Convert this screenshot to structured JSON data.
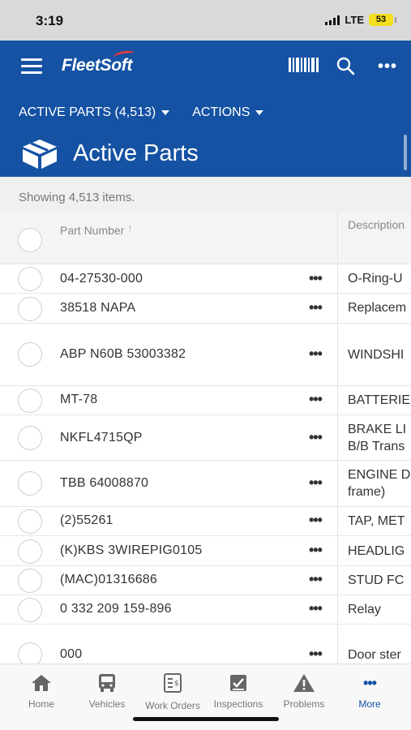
{
  "status_bar": {
    "time": "3:19",
    "network": "LTE",
    "battery": "53"
  },
  "header": {
    "logo": "FleetSoft",
    "filter_label": "ACTIVE PARTS (4,513)",
    "actions_label": "ACTIONS",
    "title": "Active Parts",
    "icons": [
      "hamburger-menu-icon",
      "barcode-icon",
      "search-icon",
      "more-icon",
      "parts-box-icon"
    ],
    "brand_color": "#1552a3"
  },
  "summary": {
    "showing_text": "Showing 4,513 items."
  },
  "table": {
    "headers": {
      "part_number": "Part Number",
      "sort_indicator": "↑",
      "description": "Description"
    },
    "rows": [
      {
        "part": "04-27530-000",
        "desc1": "O-Ring-U",
        "desc2": ""
      },
      {
        "part": "38518 NAPA",
        "desc1": "Replacem",
        "desc2": ""
      },
      {
        "part": "ABP N60B 53003382",
        "desc1": "WINDSHI",
        "desc2": ""
      },
      {
        "part": "MT-78",
        "desc1": "BATTERIE",
        "desc2": ""
      },
      {
        "part": "NKFL4715QP",
        "desc1": "BRAKE LI",
        "desc2": "B/B Trans"
      },
      {
        "part": "TBB 64008870",
        "desc1": "ENGINE D",
        "desc2": "frame)"
      },
      {
        "part": "(2)55261",
        "desc1": "TAP, MET",
        "desc2": ""
      },
      {
        "part": "(K)KBS 3WIREPIG0105",
        "desc1": "HEADLIG",
        "desc2": ""
      },
      {
        "part": "(MAC)01316686",
        "desc1": "STUD FC",
        "desc2": ""
      },
      {
        "part": "0 332 209 159-896",
        "desc1": "Relay",
        "desc2": ""
      },
      {
        "part": "000",
        "desc1": "Door ster",
        "desc2": ""
      }
    ],
    "row_action": "•••"
  },
  "bottom_nav": {
    "items": [
      {
        "label": "Home",
        "icon": "home-icon"
      },
      {
        "label": "Vehicles",
        "icon": "bus-icon"
      },
      {
        "label": "Work Orders",
        "icon": "work-order-icon"
      },
      {
        "label": "Inspections",
        "icon": "inspection-clipboard-icon"
      },
      {
        "label": "Problems",
        "icon": "warning-icon"
      },
      {
        "label": "More",
        "icon": "more-icon"
      }
    ],
    "active": "More",
    "active_color": "#1552a3"
  }
}
